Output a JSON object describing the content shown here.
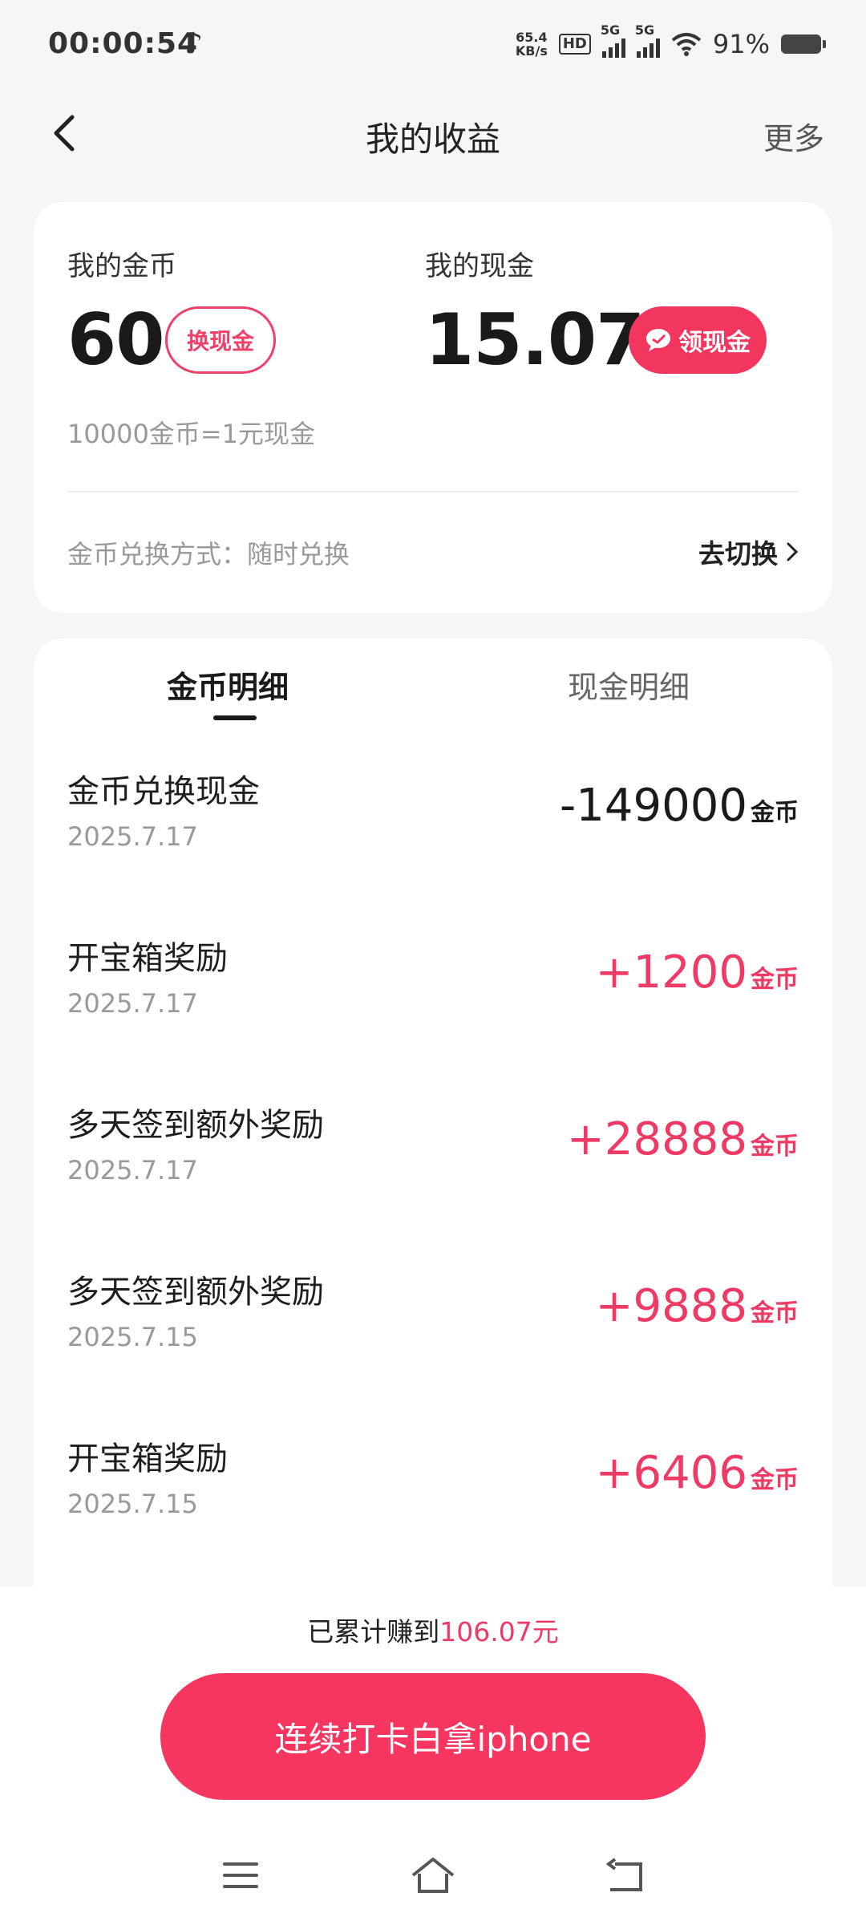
{
  "status": {
    "time": "00:00:54",
    "net_speed_value": "65.4",
    "net_speed_unit": "KB/s",
    "hd_label": "HD",
    "sim1_label": "5G",
    "sim2_label": "5G",
    "battery": "91%"
  },
  "nav": {
    "title": "我的收益",
    "more_label": "更多"
  },
  "balance": {
    "coins_label": "我的金币",
    "coins_value": "60",
    "exchange_btn": "换现金",
    "cash_label": "我的现金",
    "cash_value": "15.07",
    "withdraw_btn": "领现金",
    "rate_text": "10000金币=1元现金",
    "method_text": "金币兑换方式：随时兑换",
    "switch_label": "去切换"
  },
  "tabs": [
    {
      "label": "金币明细",
      "active": true
    },
    {
      "label": "现金明细",
      "active": false
    }
  ],
  "transactions": [
    {
      "title": "金币兑换现金",
      "date": "2025.7.17",
      "amount": "-149000",
      "unit": "金币"
    },
    {
      "title": "开宝箱奖励",
      "date": "2025.7.17",
      "amount": "+1200",
      "unit": "金币"
    },
    {
      "title": "多天签到额外奖励",
      "date": "2025.7.17",
      "amount": "+28888",
      "unit": "金币"
    },
    {
      "title": "多天签到额外奖励",
      "date": "2025.7.15",
      "amount": "+9888",
      "unit": "金币"
    },
    {
      "title": "开宝箱奖励",
      "date": "2025.7.15",
      "amount": "+6406",
      "unit": "金币"
    }
  ],
  "footer": {
    "total_prefix": "已累计赚到",
    "total_amount": "106.07元",
    "cta_label": "连续打卡白拿iphone"
  },
  "colors": {
    "accent": "#f3365e",
    "positive": "#ee3a64",
    "background": "#f6f6f6"
  },
  "icons": {
    "back": "chevron-left-icon",
    "switch": "chevron-right-icon",
    "withdraw": "chat-bubble-icon",
    "nav_menu": "menu-icon",
    "nav_home": "home-icon",
    "nav_back": "return-icon"
  }
}
